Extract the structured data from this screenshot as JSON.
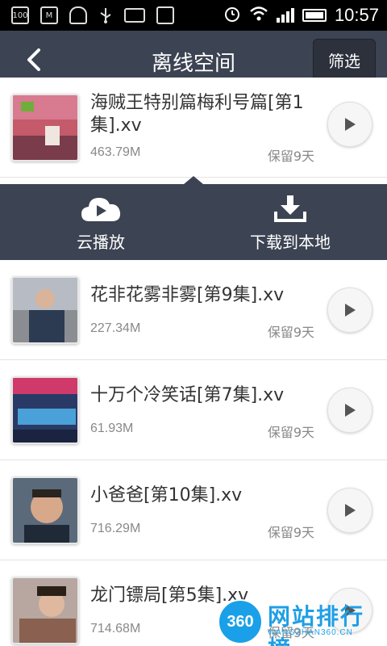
{
  "status_bar": {
    "time": "10:57",
    "left_icons": [
      "battery-100-icon",
      "app-icon",
      "android-icon",
      "usb-icon",
      "mail-icon",
      "app2-icon"
    ],
    "battery_text": "100",
    "right_icons": [
      "alarm-icon",
      "wifi-icon",
      "signal-icon",
      "battery-icon"
    ]
  },
  "header": {
    "title": "离线空间",
    "filter_label": "筛选",
    "back_icon": "back-arrow-icon",
    "color": "#3c4352"
  },
  "items": [
    {
      "name": "海贼王特别篇梅利号篇[第1集].xv",
      "size": "463.79M",
      "keep": "保留9天"
    },
    {
      "name": "花非花雾非雾[第9集].xv",
      "size": "227.34M",
      "keep": "保留9天"
    },
    {
      "name": "十万个冷笑话[第7集].xv",
      "size": "61.93M",
      "keep": "保留9天"
    },
    {
      "name": "小爸爸[第10集].xv",
      "size": "716.29M",
      "keep": "保留9天"
    },
    {
      "name": "龙门镖局[第5集].xv",
      "size": "714.68M",
      "keep": "保留9天"
    }
  ],
  "action_panel": {
    "cloud_play_label": "云播放",
    "download_local_label": "下载到本地",
    "cloud_icon": "cloud-play-icon",
    "download_icon": "download-icon"
  },
  "watermark": {
    "badge": "360",
    "title": "网站排行榜",
    "subtitle": "WANGZHAN360.CN"
  }
}
